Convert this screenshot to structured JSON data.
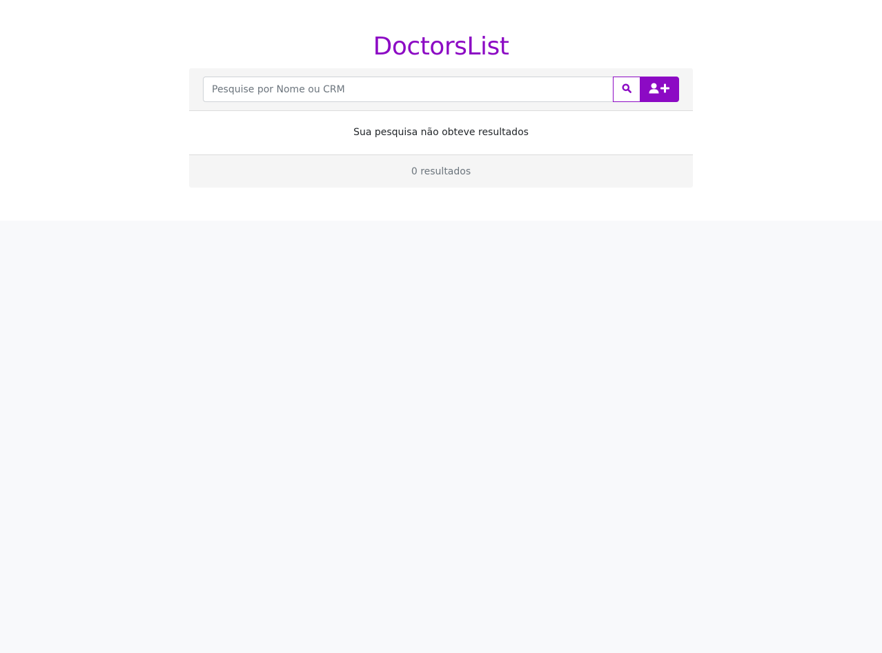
{
  "app": {
    "title": "DoctorsList",
    "accent_color": "#8c0ac4"
  },
  "search": {
    "placeholder": "Pesquise por Nome ou CRM",
    "value": "",
    "search_icon": "search-icon",
    "add_icon": "user-plus-icon"
  },
  "results": {
    "empty_message": "Sua pesquisa não obteve resultados",
    "count_label": "0 resultados"
  }
}
